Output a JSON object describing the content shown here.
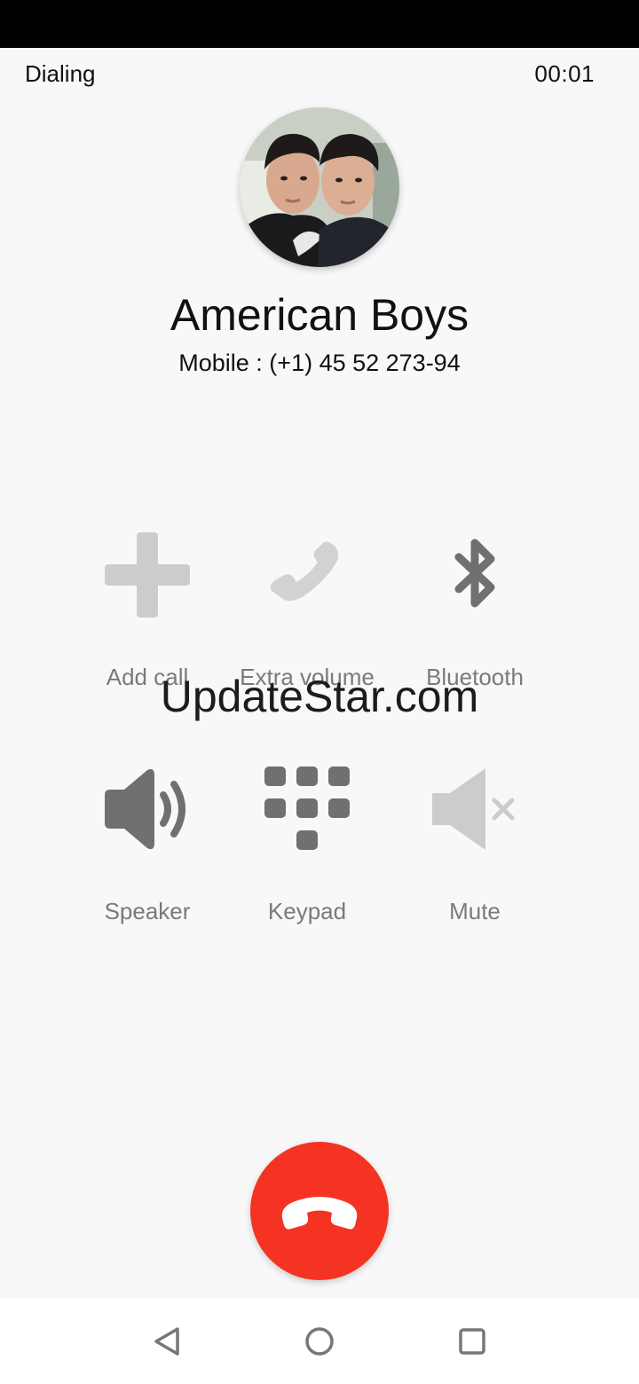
{
  "call": {
    "state": "Dialing",
    "timer": "00:01"
  },
  "contact": {
    "name": "American Boys",
    "number": "Mobile : (+1) 45 52 273-94"
  },
  "actions": [
    {
      "label": "Add call",
      "icon": "add-call-icon",
      "enabled": false
    },
    {
      "label": "Extra volume",
      "icon": "phone-volume-icon",
      "enabled": false
    },
    {
      "label": "Bluetooth",
      "icon": "bluetooth-icon",
      "enabled": true
    },
    {
      "label": "Speaker",
      "icon": "speaker-icon",
      "enabled": true
    },
    {
      "label": "Keypad",
      "icon": "keypad-icon",
      "enabled": true
    },
    {
      "label": "Mute",
      "icon": "mute-icon",
      "enabled": false
    }
  ],
  "watermark": "UpdateStar.com",
  "colors": {
    "end_call": "#f53322",
    "icon_enabled": "#707070",
    "icon_disabled": "#cccccc",
    "label": "#7a7a7a"
  }
}
